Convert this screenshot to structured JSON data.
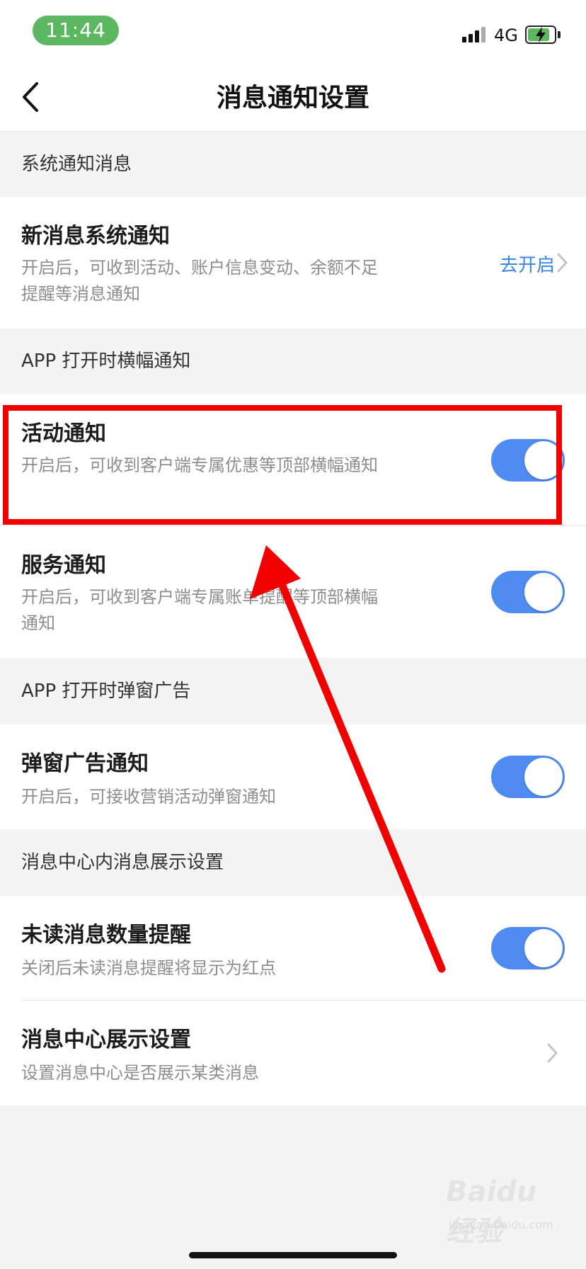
{
  "status_bar": {
    "time": "11:44",
    "network": "4G",
    "icons": [
      "signal-icon",
      "battery-charging-icon"
    ]
  },
  "nav": {
    "title": "消息通知设置",
    "back_icon": "chevron-left-icon"
  },
  "sections": [
    {
      "header": "系统通知消息",
      "rows": [
        {
          "title": "新消息系统通知",
          "desc": "开启后，可收到活动、账户信息变动、余额不足提醒等消息通知",
          "action_label": "去开启"
        }
      ]
    },
    {
      "header": "APP 打开时横幅通知",
      "rows": [
        {
          "title": "活动通知",
          "desc": "开启后，可收到客户端专属优惠等顶部横幅通知",
          "toggle_on": true
        },
        {
          "title": "服务通知",
          "desc": "开启后，可收到客户端专属账单提醒等顶部横幅通知",
          "toggle_on": true
        }
      ]
    },
    {
      "header": "APP 打开时弹窗广告",
      "rows": [
        {
          "title": "弹窗广告通知",
          "desc": "开启后，可接收营销活动弹窗通知",
          "toggle_on": true
        }
      ]
    },
    {
      "header": "消息中心内消息展示设置",
      "rows": [
        {
          "title": "未读消息数量提醒",
          "desc": "关闭后未读消息提醒将显示为红点",
          "toggle_on": true
        },
        {
          "title": "消息中心展示设置",
          "desc": "设置消息中心是否展示某类消息"
        }
      ]
    }
  ],
  "annotation": {
    "highlight_color": "#f10000",
    "arrow_color": "#f10000"
  },
  "watermark": {
    "brand": "Baidu经验",
    "site": "jingyan.baidu.com"
  },
  "colors": {
    "toggle_on": "#4f8cf2",
    "link": "#3a86e4",
    "time_pill": "#5cb860"
  }
}
